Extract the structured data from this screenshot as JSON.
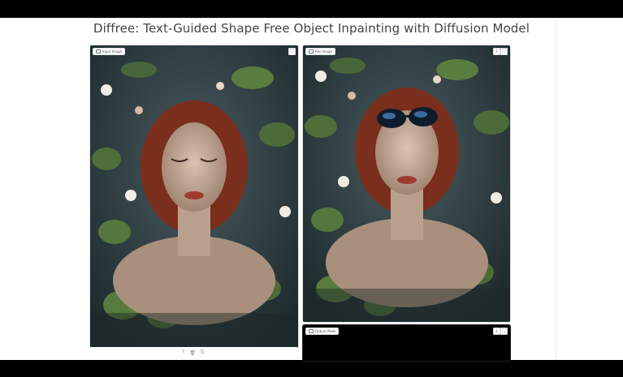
{
  "title": "Diffree: Text-Guided Shape Free Object Inpainting with Diffusion Model",
  "panels": {
    "input": {
      "label": "Input Image"
    },
    "result": {
      "label": "Res Image"
    },
    "mask": {
      "label": "Output Mask"
    }
  },
  "icons": {
    "download": "⤓",
    "fullscreen": "⛶",
    "upload": "⤒",
    "trash": "🗑",
    "copy": "⎘"
  }
}
